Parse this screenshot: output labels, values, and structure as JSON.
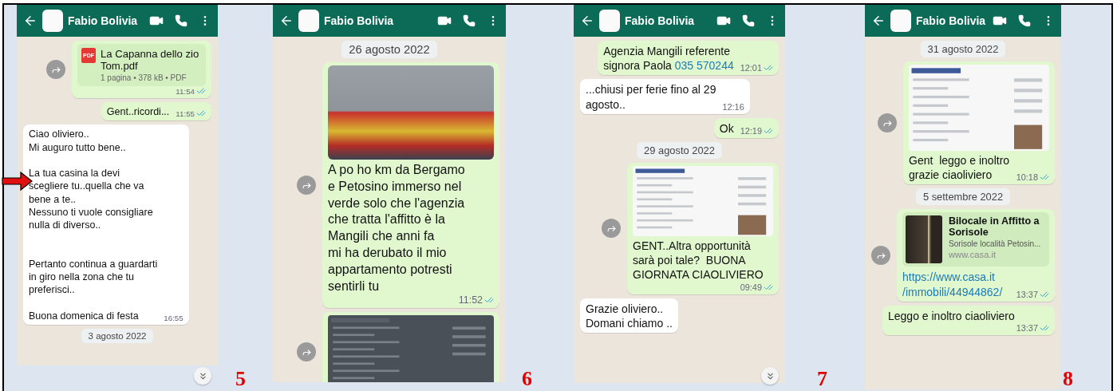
{
  "panels": [
    {
      "number": "5",
      "contact": "Fabio Bolivia",
      "scroll_down": true,
      "pointer": true,
      "messages": [
        {
          "kind": "file",
          "incoming": false,
          "forward": true,
          "file_type": "PDF",
          "title": "La Capanna dello zio\nTom.pdf",
          "meta": "1 pagina • 378 kB • PDF",
          "time": "11:54",
          "read": true
        },
        {
          "kind": "text",
          "incoming": false,
          "text": "Gent..ricordi...",
          "time": "11:55",
          "read": true
        },
        {
          "kind": "text",
          "incoming": true,
          "text": "Ciao oliviero..\nMi auguro tutto bene..\n\nLa tua casina la devi\nscegliere tu..quella che va\nbene a te..\nNessuno ti vuole consigliare\nnulla di diverso..\n\n\nPertanto continua a guardarti\nin giro nella zona che tu\npreferisci..\n\nBuona domenica di festa",
          "time": "16:55"
        },
        {
          "kind": "date",
          "text": "3 agosto 2022"
        }
      ]
    },
    {
      "number": "6",
      "contact": "Fabio Bolivia",
      "messages": [
        {
          "kind": "date",
          "text": "26 agosto 2022"
        },
        {
          "kind": "photo",
          "incoming": false,
          "forward": true,
          "caption": "A po ho km da Bergamo\ne Petosino immerso nel\nverde solo che l'agenzia\nche tratta l'affitto è la\nMangili che anni fa\nmi ha derubato il mio\nappartamento potresti\nsentirli tu",
          "time": "11:52",
          "read": true
        },
        {
          "kind": "screenshot",
          "incoming": false,
          "forward": true
        }
      ]
    },
    {
      "number": "7",
      "contact": "Fabio Bolivia",
      "scroll_down": true,
      "messages": [
        {
          "kind": "text",
          "incoming": false,
          "text": "Agenzia Mangili referente\nsignora Paola",
          "link": "035 570244",
          "time": "12:01",
          "read": true
        },
        {
          "kind": "text",
          "incoming": true,
          "text": "...chiusi per ferie fino al 29\nagosto..",
          "time": "12:16"
        },
        {
          "kind": "text",
          "incoming": false,
          "text": "Ok",
          "time": "12:19",
          "read": true
        },
        {
          "kind": "date",
          "text": "29 agosto 2022"
        },
        {
          "kind": "screenshot",
          "incoming": false,
          "forward": true,
          "caption": "GENT..Altra opportunità\nsarà poi tale?  BUONA\nGIORNATA CIAOLIVIERO",
          "time": "09:49",
          "read": true
        },
        {
          "kind": "text",
          "incoming": true,
          "text": "Grazie oliviero..\nDomani chiamo .."
        }
      ]
    },
    {
      "number": "8",
      "contact": "Fabio Bolivia",
      "messages": [
        {
          "kind": "date",
          "text": "31 agosto 2022"
        },
        {
          "kind": "screenshot",
          "incoming": false,
          "forward": true,
          "caption": "Gent  leggo e inoltro\ngrazie ciaoliviero",
          "time": "10:18",
          "read": true
        },
        {
          "kind": "date",
          "text": "5 settembre 2022"
        },
        {
          "kind": "link",
          "incoming": false,
          "forward": true,
          "title": "Bilocale in Affitto a\nSorisole",
          "description": "Sorisole località Petosin...",
          "domain": "www.casa.it",
          "url": "https://www.casa.it\n/immobili/44944862/",
          "time": "13:37",
          "read": true
        },
        {
          "kind": "text",
          "incoming": false,
          "text": "Leggo e inoltro ciaoliviero",
          "time": "13:37",
          "read": true
        }
      ]
    }
  ]
}
